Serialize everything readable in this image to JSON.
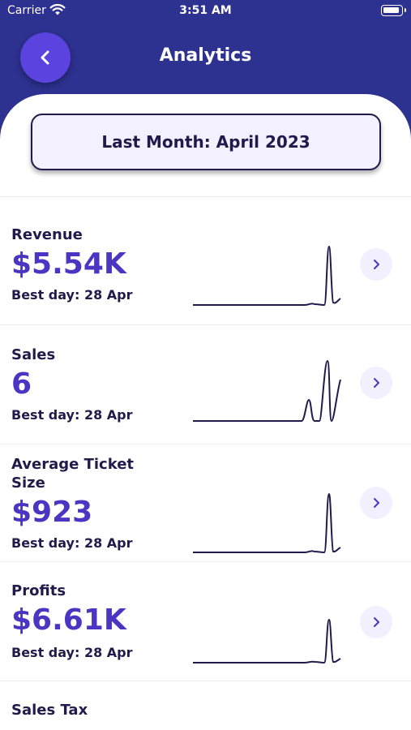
{
  "status": {
    "carrier": "Carrier",
    "time": "3:51 AM"
  },
  "nav": {
    "title": "Analytics"
  },
  "period": {
    "label": "Last Month: April 2023"
  },
  "metrics": [
    {
      "label": "Revenue",
      "value": "$5.54K",
      "best": "Best day: 28 Apr"
    },
    {
      "label": "Sales",
      "value": "6",
      "best": "Best day: 28 Apr"
    },
    {
      "label": "Average Ticket Size",
      "value": "$923",
      "best": "Best day: 28 Apr"
    },
    {
      "label": "Profits",
      "value": "$6.61K",
      "best": "Best day: 28 Apr"
    },
    {
      "label": "Sales Tax",
      "value": "",
      "best": ""
    }
  ],
  "colors": {
    "header": "#2d3190",
    "accent": "#5b43e0",
    "value": "#4a36c2",
    "text": "#211a4a"
  }
}
